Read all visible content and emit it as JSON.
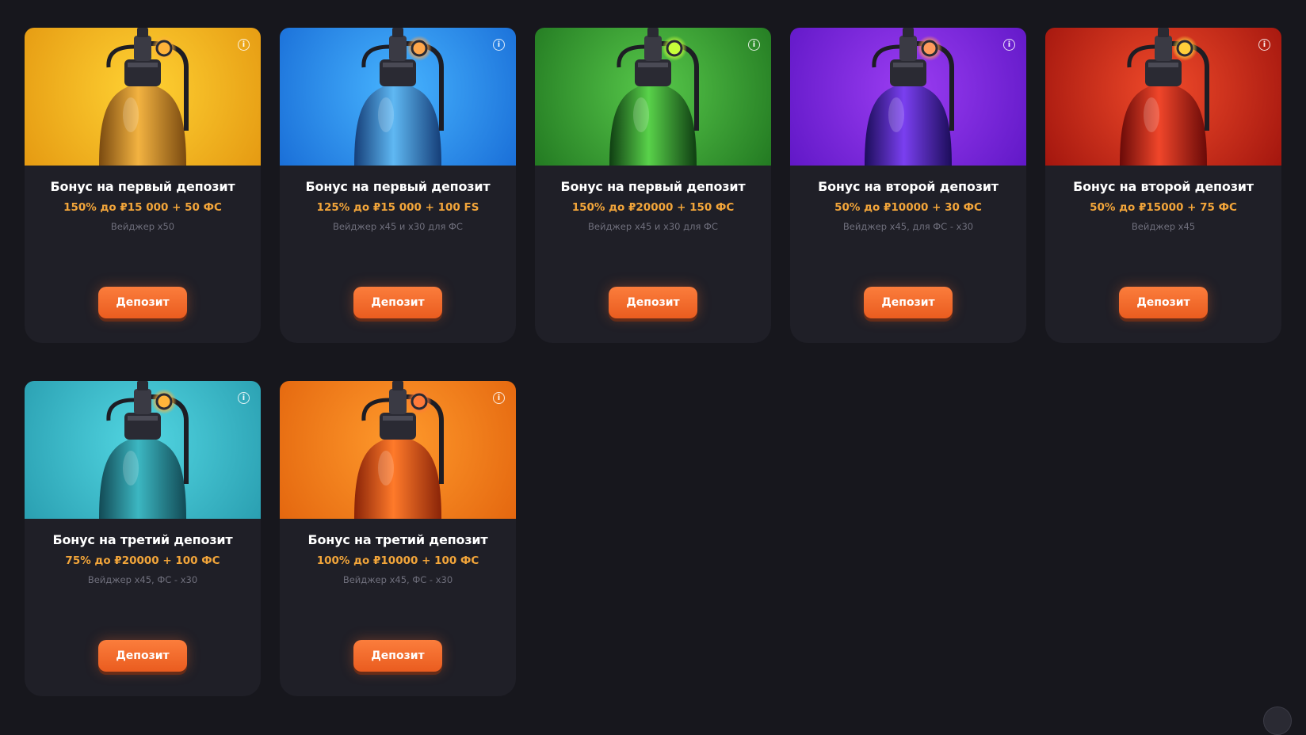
{
  "deposit_label": "Депозит",
  "info_glyph": "i",
  "cards": [
    {
      "title": "Бонус на первый депозит",
      "offer": "150% до ₽15 000 + 50 ФС",
      "terms": "Вейджер x50",
      "theme": "yellow",
      "bg_from": "#ffd233",
      "bg_to": "#e59a12",
      "body_from": "#f3b341",
      "body_to": "#7a4a10",
      "lamp": "#ffb23a"
    },
    {
      "title": "Бонус на первый депозит",
      "offer": "125% до ₽15 000 + 100 FS",
      "terms": "Вейджер x45 и x30 для ФС",
      "theme": "blue",
      "bg_from": "#47b4ff",
      "bg_to": "#1a6fd8",
      "body_from": "#5fb8f3",
      "body_to": "#153e78",
      "lamp": "#ffa64a"
    },
    {
      "title": "Бонус на первый депозит",
      "offer": "150% до ₽20000 + 150 ФС",
      "terms": "Вейджер x45 и x30 для ФС",
      "theme": "green",
      "bg_from": "#57c84a",
      "bg_to": "#237a22",
      "body_from": "#59d24a",
      "body_to": "#0f3e12",
      "lamp": "#c7ff3a"
    },
    {
      "title": "Бонус на второй депозит",
      "offer": "50% до ₽10000 + 30 ФС",
      "terms": "Вейджер x45, для ФС - x30",
      "theme": "purple",
      "bg_from": "#9b3df2",
      "bg_to": "#6118c7",
      "body_from": "#7a3ff0",
      "body_to": "#1c0d5a",
      "lamp": "#ff9a5c"
    },
    {
      "title": "Бонус на второй депозит",
      "offer": "50% до ₽15000 + 75 ФС",
      "terms": "Вейджер x45",
      "theme": "red",
      "bg_from": "#f04a2a",
      "bg_to": "#a3160e",
      "body_from": "#f0462a",
      "body_to": "#6a0a08",
      "lamp": "#ffcf3a"
    },
    {
      "title": "Бонус на третий депозит",
      "offer": "75% до ₽20000 + 100 ФС",
      "terms": "Вейджер x45, ФС - x30",
      "theme": "teal",
      "bg_from": "#52d6e2",
      "bg_to": "#2a9fb1",
      "body_from": "#3cb7c2",
      "body_to": "#124a55",
      "lamp": "#ffb43a"
    },
    {
      "title": "Бонус на третий депозит",
      "offer": "100% до ₽10000 + 100 ФС",
      "terms": "Вейджер x45, ФС - x30",
      "theme": "orange",
      "bg_from": "#ff9a2c",
      "bg_to": "#e4670f",
      "body_from": "#ff7a2a",
      "body_to": "#8a2408",
      "lamp": "#ff7a3a"
    }
  ]
}
